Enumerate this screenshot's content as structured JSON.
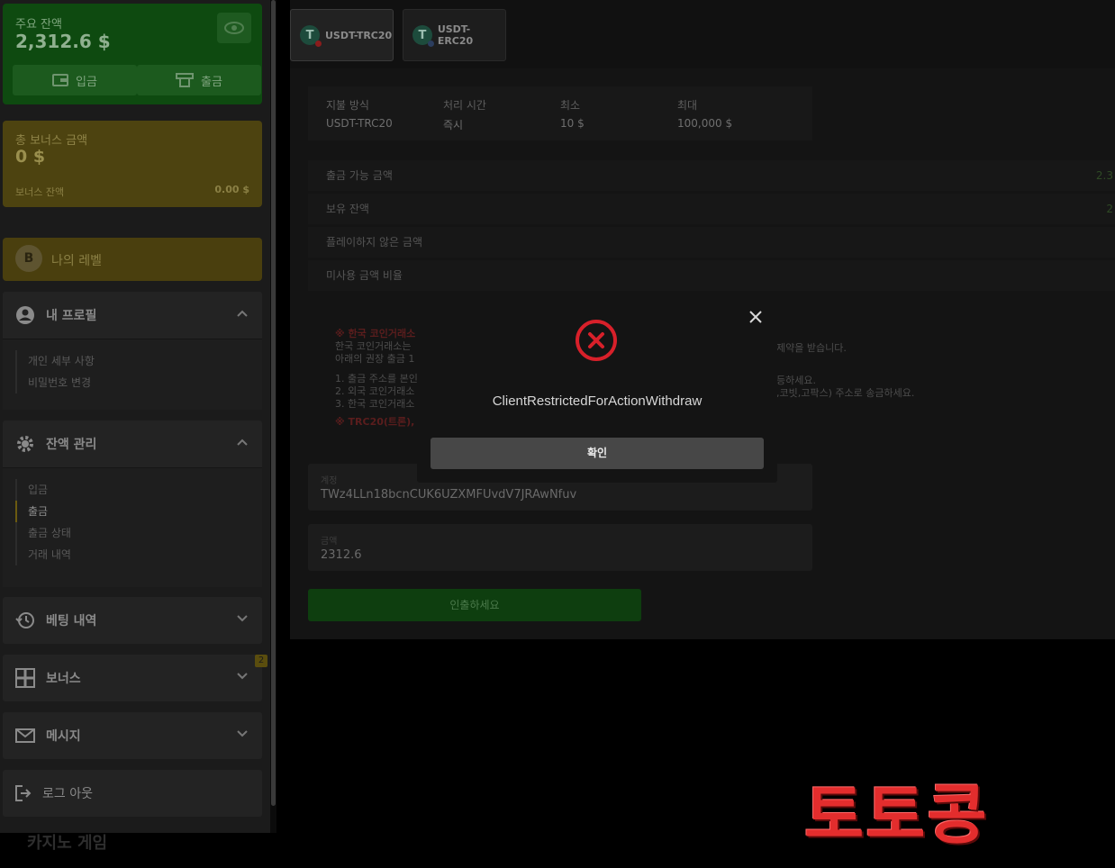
{
  "sidebar": {
    "main_balance": {
      "label": "주요 잔액",
      "value": "2,312.6 $",
      "deposit": "입금",
      "withdraw": "출금"
    },
    "bonus": {
      "label": "총 보너스 금액",
      "value": "0 $",
      "sub_label": "보너스 잔액",
      "sub_value": "0.00 $"
    },
    "level": {
      "coin": "B",
      "label": "나의 레벨"
    },
    "profile": {
      "title": "내 프로필",
      "items": [
        "개인 세부 사항",
        "비밀번호 변경"
      ]
    },
    "balance_mgmt": {
      "title": "잔액 관리",
      "items": [
        "입금",
        "출금",
        "출금 상태",
        "거래 내역"
      ]
    },
    "betting": {
      "title": "베팅 내역"
    },
    "bonus_menu": {
      "title": "보너스",
      "badge": "2"
    },
    "messages": {
      "title": "메시지"
    },
    "logout": {
      "title": "로그 아웃"
    },
    "casino": "카지노 게임"
  },
  "tabs": [
    {
      "label": "USDT-TRC20",
      "icon": "T"
    },
    {
      "label": "USDT-ERC20",
      "icon": "T"
    }
  ],
  "info": {
    "method_label": "지불 방식",
    "method_value": "USDT-TRC20",
    "time_label": "처리 시간",
    "time_value": "즉시",
    "min_label": "최소",
    "min_value": "10 $",
    "max_label": "최대",
    "max_value": "100,000 $"
  },
  "stats": [
    {
      "label": "출금 가능 금액",
      "value": "2.3"
    },
    {
      "label": "보유 잔액",
      "value": "2"
    },
    {
      "label": "플레이하지 않은 금액",
      "value": ""
    },
    {
      "label": "미사용 금액 비율",
      "value": ""
    }
  ],
  "notice": {
    "line1": "※ 한국 코인거래소",
    "line2": "한국 코인거래소는",
    "line2_right": "제약을 받습니다.",
    "line3": "아래의 권장 출금 1",
    "line4": "1. 출금 주소를 본인",
    "line4_right": "등하세요.",
    "line5": "2. 외국 코인거래소",
    "line5_right": ",코빗,고팍스) 주소로 송금하세요.",
    "line6": "3. 한국 코인거래소",
    "line7": "※ TRC20(트론),"
  },
  "form": {
    "account_label": "계정",
    "account_value": "TWz4LLn18bcnCUK6UZXMFUvdV7JRAwNfuv",
    "amount_label": "금액",
    "amount_value": "2312.6",
    "submit": "인출하세요"
  },
  "modal": {
    "message": "ClientRestrictedForActionWithdraw",
    "ok": "확인"
  },
  "watermark": "토토콩"
}
